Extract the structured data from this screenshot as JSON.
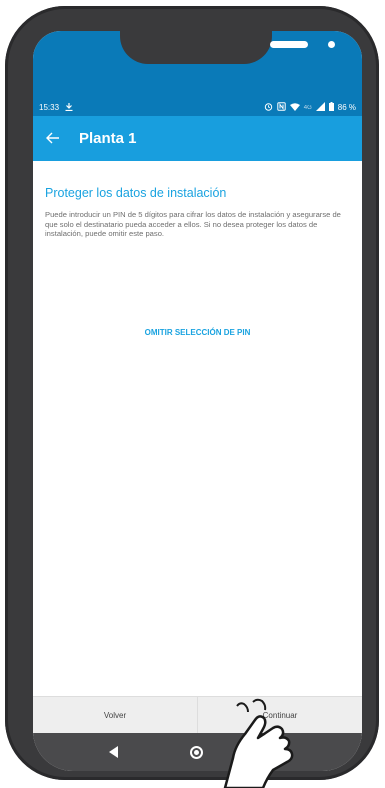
{
  "status_bar": {
    "time": "15:33",
    "download_icon": "download-icon",
    "icons": [
      "alarm-icon",
      "nfc-icon",
      "wifi-icon",
      "4g-icon",
      "signal-icon",
      "battery-icon"
    ],
    "network": "4G",
    "battery": "86 %"
  },
  "app_bar": {
    "title": "Planta 1",
    "back_icon": "back-arrow-icon"
  },
  "main": {
    "title": "Proteger los datos de instalación",
    "description": "Puede introducir un PIN de 5 dígitos para cifrar los datos de instalación y asegurarse de que solo el destinatario pueda acceder a ellos. Si no desea proteger los datos de instalación, puede omitir este paso.",
    "skip_link": "OMITIR SELECCIÓN DE PIN"
  },
  "bottom_bar": {
    "back_label": "Volver",
    "continue_label": "Continuar"
  },
  "nav_bar": {
    "icons": [
      "nav-back-icon",
      "nav-home-icon",
      "nav-recents-icon"
    ]
  },
  "colors": {
    "status_bar": "#0a7ab8",
    "app_bar": "#189ede",
    "accent_text": "#1aa3e0",
    "phone_frame": "#3a3a3c"
  }
}
